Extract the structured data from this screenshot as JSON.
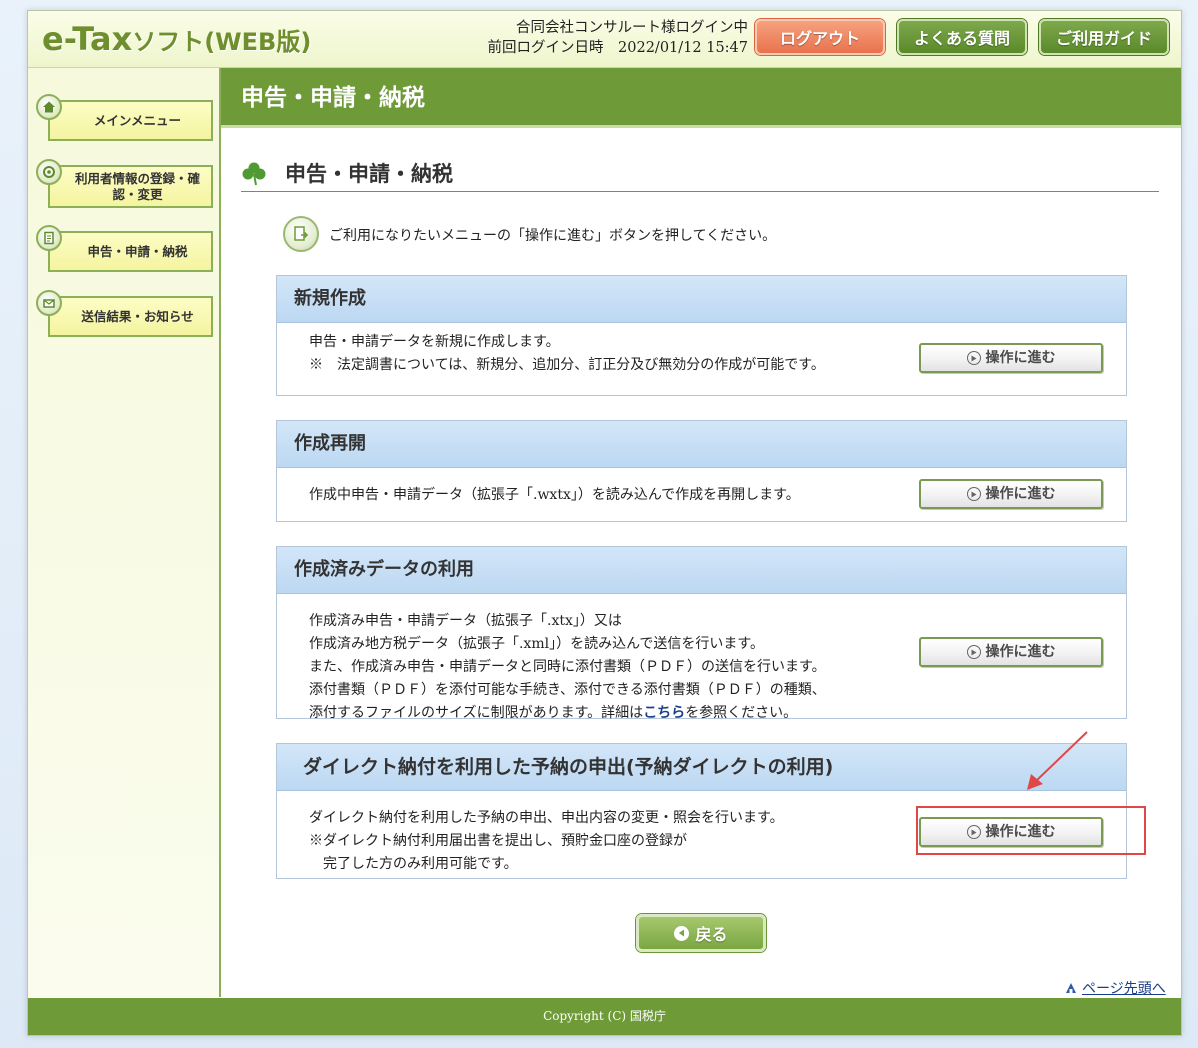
{
  "header": {
    "logo_main": "e-Tax",
    "logo_sub": "ソフト(WEB版)",
    "login_user": "合同会社コンサルート様ログイン中",
    "last_login": "前回ログイン日時　2022/01/12 15:47",
    "logout_label": "ログアウト",
    "faq_label": "よくある質問",
    "guide_label": "ご利用ガイド"
  },
  "sidebar": {
    "items": [
      {
        "label": "メインメニュー",
        "icon": "home-icon"
      },
      {
        "label": "利用者情報の登録・確認・変更",
        "icon": "user-info-icon"
      },
      {
        "label": "申告・申請・納税",
        "icon": "document-icon"
      },
      {
        "label": "送信結果・お知らせ",
        "icon": "notice-icon"
      }
    ]
  },
  "main": {
    "title": "申告・申請・納税",
    "section_title": "申告・申請・納税",
    "instruction": "ご利用になりたいメニューの「操作に進む」ボタンを押してください。",
    "go_label": "操作に進む",
    "panels": [
      {
        "title": "新規作成",
        "lines": [
          "申告・申請データを新規に作成します。",
          "※　法定調書については、新規分、追加分、訂正分及び無効分の作成が可能です。"
        ]
      },
      {
        "title": "作成再開",
        "lines": [
          "作成中申告・申請データ（拡張子「.wxtx」）を読み込んで作成を再開します。"
        ]
      },
      {
        "title": "作成済みデータの利用",
        "lines": [
          "作成済み申告・申請データ（拡張子「.xtx」）又は",
          "作成済み地方税データ（拡張子「.xml」）を読み込んで送信を行います。",
          "また、作成済み申告・申請データと同時に添付書類（ＰＤＦ）の送信を行います。",
          "添付書類（ＰＤＦ）を添付可能な手続き、添付できる添付書類（ＰＤＦ）の種類、"
        ],
        "last_line_pre": "添付するファイルのサイズに制限があります。詳細は",
        "last_line_link": "こちら",
        "last_line_post": "を参照ください。"
      },
      {
        "title": "ダイレクト納付を利用した予納の申出(予納ダイレクトの利用)",
        "lines": [
          "ダイレクト納付を利用した予納の申出、申出内容の変更・照会を行います。",
          "※ダイレクト納付利用届出書を提出し、預貯金口座の登録が",
          "　完了した方のみ利用可能です。"
        ]
      }
    ],
    "back_label": "戻る",
    "page_top_label": "ページ先頭へ"
  },
  "footer": {
    "copyright": "Copyright (C) 国税庁"
  },
  "colors": {
    "brand_green": "#6e9b38",
    "panel_blue": "#c6dff5",
    "logout_orange": "#e8734d",
    "highlight_red": "#e04848"
  }
}
